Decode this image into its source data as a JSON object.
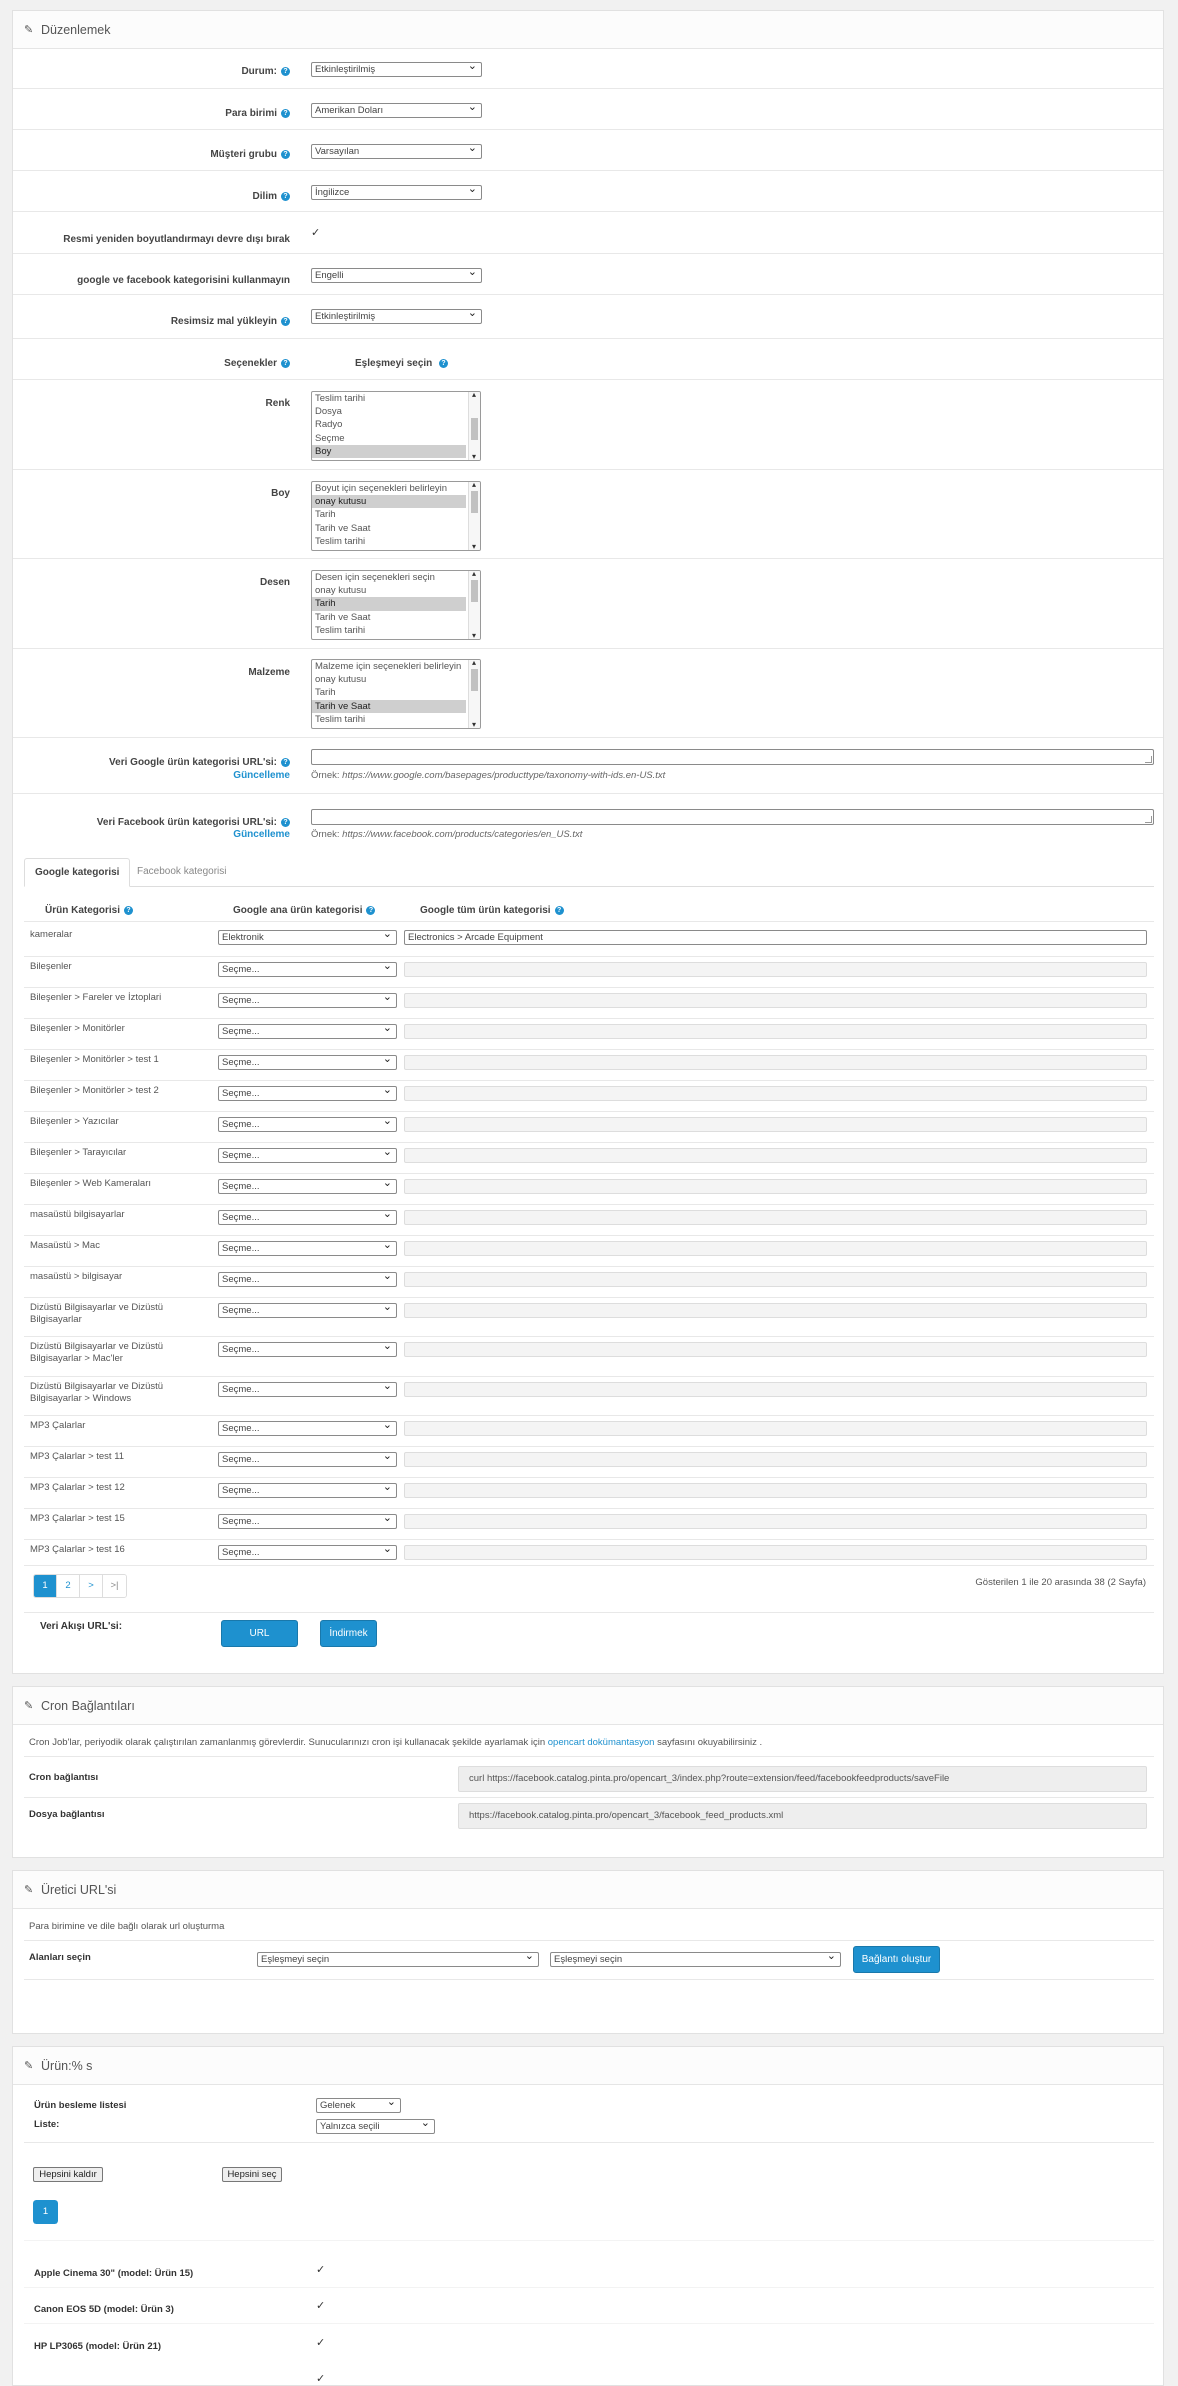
{
  "edit_panel": {
    "title": "Düzenlemek",
    "status": {
      "label": "Durum:",
      "value": "Etkinleştirilmiş"
    },
    "currency": {
      "label": "Para birimi",
      "value": "Amerikan Doları"
    },
    "customer_group": {
      "label": "Müşteri grubu",
      "value": "Varsayılan"
    },
    "language": {
      "label": "Dilim",
      "value": "İngilizce"
    },
    "disable_resize": {
      "label": "Resmi yeniden boyutlandırmayı devre dışı bırak",
      "checked": true
    },
    "no_categories": {
      "label": "google ve facebook kategorisini kullanmayın",
      "value": "Engelli"
    },
    "no_image_upload": {
      "label": "Resimsiz mal yükleyin",
      "value": "Etkinleştirilmiş"
    },
    "options_label": "Seçenekler",
    "mapping_label": "Eşleşmeyi seçin",
    "option_lists": [
      {
        "label": "Renk",
        "items": [
          "Teslim tarihi",
          "Dosya",
          "Radyo",
          "Seçme",
          "Boy"
        ],
        "selected": [
          4
        ]
      },
      {
        "label": "Boy",
        "items": [
          "Boyut için seçenekleri belirleyin",
          "onay kutusu",
          "Tarih",
          "Tarih ve Saat",
          "Teslim tarihi"
        ],
        "selected": [
          1
        ]
      },
      {
        "label": "Desen",
        "items": [
          "Desen için seçenekleri seçin",
          "onay kutusu",
          "Tarih",
          "Tarih ve Saat",
          "Teslim tarihi"
        ],
        "selected": [
          2
        ]
      },
      {
        "label": "Malzeme",
        "items": [
          "Malzeme için seçenekleri belirleyin",
          "onay kutusu",
          "Tarih",
          "Tarih ve Saat",
          "Teslim tarihi"
        ],
        "selected": [
          3
        ]
      }
    ],
    "google_url": {
      "label": "Veri Google ürün kategorisi URL'si:",
      "update": "Güncelleme",
      "example_prefix": "Örnek:",
      "example": "https://www.google.com/basepages/producttype/taxonomy-with-ids.en-US.txt"
    },
    "facebook_url": {
      "label": "Veri Facebook ürün kategorisi URL'si:",
      "update": "Güncelleme",
      "example_prefix": "Örnek:",
      "example": "https://www.facebook.com/products/categories/en_US.txt"
    },
    "tabs": [
      "Google kategorisi",
      "Facebook kategorisi"
    ],
    "table_headers": [
      "Ürün Kategorisi",
      "Google ana ürün kategorisi",
      "Google tüm ürün kategorisi"
    ],
    "rows": [
      {
        "category": "kameralar",
        "main": "Elektronik",
        "full": "Electronics > Arcade Equipment"
      },
      {
        "category": "Bileşenler",
        "main": "Seçme...",
        "full": ""
      },
      {
        "category": "Bileşenler > Fareler ve İztoplari",
        "main": "Seçme...",
        "full": ""
      },
      {
        "category": "Bileşenler > Monitörler",
        "main": "Seçme...",
        "full": ""
      },
      {
        "category": "Bileşenler > Monitörler > test 1",
        "main": "Seçme...",
        "full": ""
      },
      {
        "category": "Bileşenler > Monitörler > test 2",
        "main": "Seçme...",
        "full": ""
      },
      {
        "category": "Bileşenler > Yazıcılar",
        "main": "Seçme...",
        "full": ""
      },
      {
        "category": "Bileşenler > Tarayıcılar",
        "main": "Seçme...",
        "full": ""
      },
      {
        "category": "Bileşenler > Web Kameraları",
        "main": "Seçme...",
        "full": ""
      },
      {
        "category": "masaüstü bilgisayarlar",
        "main": "Seçme...",
        "full": ""
      },
      {
        "category": "Masaüstü > Mac",
        "main": "Seçme...",
        "full": ""
      },
      {
        "category": "masaüstü > bilgisayar",
        "main": "Seçme...",
        "full": ""
      },
      {
        "category": "Dizüstü Bilgisayarlar ve Dizüstü Bilgisayarlar",
        "main": "Seçme...",
        "full": ""
      },
      {
        "category": "Dizüstü Bilgisayarlar ve Dizüstü Bilgisayarlar > Mac'ler",
        "main": "Seçme...",
        "full": ""
      },
      {
        "category": "Dizüstü Bilgisayarlar ve Dizüstü Bilgisayarlar > Windows",
        "main": "Seçme...",
        "full": ""
      },
      {
        "category": "MP3 Çalarlar",
        "main": "Seçme...",
        "full": ""
      },
      {
        "category": "MP3 Çalarlar > test 11",
        "main": "Seçme...",
        "full": ""
      },
      {
        "category": "MP3 Çalarlar > test 12",
        "main": "Seçme...",
        "full": ""
      },
      {
        "category": "MP3 Çalarlar > test 15",
        "main": "Seçme...",
        "full": ""
      },
      {
        "category": "MP3 Çalarlar > test 16",
        "main": "Seçme...",
        "full": ""
      }
    ],
    "pagination": [
      "1",
      "2",
      ">",
      ">|"
    ],
    "pagination_info": "Gösterilen 1 ile 20 arasında 38 (2 Sayfa)",
    "feed_url_label": "Veri Akışı URL'si:",
    "url_button": "URL",
    "download_button": "İndirmek"
  },
  "cron_panel": {
    "title": "Cron Bağlantıları",
    "desc_before": "Cron Job'lar, periyodik olarak çalıştırılan zamanlanmış görevlerdir. Sunucularınızı cron işi kullanacak şekilde ayarlamak için",
    "desc_link": "opencart dokümantasyon",
    "desc_after": "sayfasını okuyabilirsiniz .",
    "cron_link_label": "Cron bağlantısı",
    "cron_link_value": "curl https://facebook.catalog.pinta.pro/opencart_3/index.php?route=extension/feed/facebookfeedproducts/saveFile",
    "file_link_label": "Dosya bağlantısı",
    "file_link_value": "https://facebook.catalog.pinta.pro/opencart_3/facebook_feed_products.xml"
  },
  "generator_panel": {
    "title": "Üretici URL'si",
    "desc": "Para birimine ve dile bağlı olarak url oluşturma",
    "fields_label": "Alanları seçin",
    "select1": "Eşleşmeyi seçin",
    "select2": "Eşleşmeyi seçin",
    "button": "Bağlantı oluştur"
  },
  "products_panel": {
    "title": "Ürün:% s",
    "feed_list_label": "Ürün besleme listesi",
    "feed_list_value": "Gelenek",
    "list_label": "Liste:",
    "list_value": "Yalnızca seçili",
    "remove_all": "Hepsini kaldır",
    "select_all": "Hepsini seç",
    "page": "1",
    "products": [
      {
        "name": "Apple Cinema 30\" (model: Ürün 15)",
        "checked": true
      },
      {
        "name": "Canon EOS 5D (model: Ürün 3)",
        "checked": true
      },
      {
        "name": "HP LP3065 (model: Ürün 21)",
        "checked": true
      }
    ]
  },
  "colors": {
    "accent": "#1e91cf",
    "panel_bg": "#ffffff",
    "page_bg": "#f1f1f1"
  }
}
